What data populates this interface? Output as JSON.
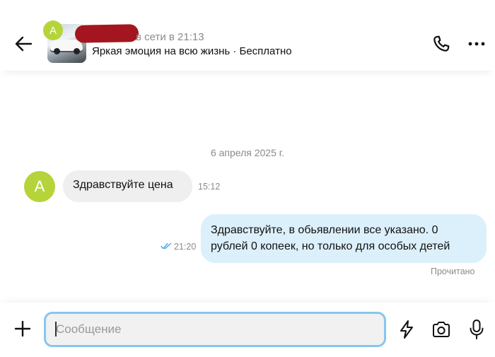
{
  "header": {
    "back_icon": "arrow-left-icon",
    "seller_initial": "A",
    "status": "в сети в 21:13",
    "listing_title": "Яркая эмоция на всю жизнь · Бесплатно",
    "phone_icon": "phone-icon",
    "more_icon": "more-horizontal-icon"
  },
  "chat": {
    "date": "6 апреля 2025 г.",
    "messages": [
      {
        "direction": "incoming",
        "avatar_initial": "A",
        "text": "Здравствуйте цена",
        "time": "15:12"
      },
      {
        "direction": "outgoing",
        "line1": "Здравствуйте, в обьявлении все указано. 0",
        "line2": "рублей 0 копеек, но только для особых детей",
        "time": "21:20",
        "status_icon": "double-check-icon"
      }
    ],
    "read_status": "Прочитано"
  },
  "composer": {
    "placeholder": "Сообщение",
    "value": "",
    "plus_icon": "plus-icon",
    "quick_reply_icon": "lightning-icon",
    "camera_icon": "camera-icon",
    "mic_icon": "microphone-icon"
  },
  "colors": {
    "avatar": "#b5d43b",
    "outgoing_bubble": "#dcf0fb",
    "incoming_bubble": "#efefef",
    "input_focus_border": "#86c7ee",
    "check": "#3aa8e8"
  }
}
